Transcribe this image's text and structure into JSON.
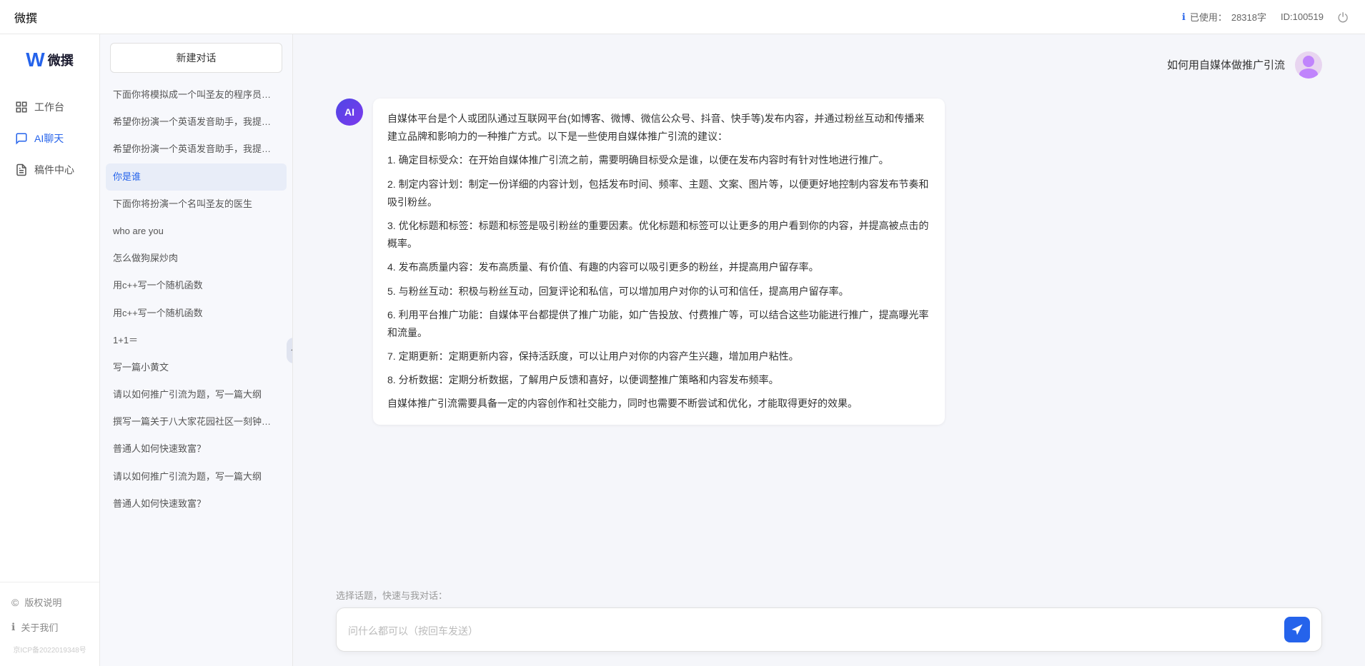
{
  "topbar": {
    "title": "微撰",
    "usage_label": "已使用：",
    "usage_value": "28318字",
    "id_label": "ID:100519",
    "power_icon": "⏻"
  },
  "logo": {
    "w": "W",
    "text": "微撰"
  },
  "nav": {
    "items": [
      {
        "id": "workbench",
        "icon": "🖥",
        "label": "工作台"
      },
      {
        "id": "ai-chat",
        "icon": "💬",
        "label": "AI聊天",
        "active": true
      },
      {
        "id": "drafts",
        "icon": "📋",
        "label": "稿件中心"
      }
    ]
  },
  "sidebar_bottom": {
    "items": [
      {
        "id": "copyright",
        "icon": "©",
        "label": "版权说明"
      },
      {
        "id": "about",
        "icon": "ℹ",
        "label": "关于我们"
      }
    ],
    "icp": "京ICP备2022019348号"
  },
  "new_chat_label": "新建对话",
  "history": {
    "items": [
      {
        "id": 1,
        "text": "下面你将模拟成一个叫圣友的程序员、我说..."
      },
      {
        "id": 2,
        "text": "希望你扮演一个英语发音助手，我提供给你..."
      },
      {
        "id": 3,
        "text": "希望你扮演一个英语发音助手，我提供给你..."
      },
      {
        "id": 4,
        "text": "你是谁",
        "active": true
      },
      {
        "id": 5,
        "text": "下面你将扮演一个名叫圣友的医生"
      },
      {
        "id": 6,
        "text": "who are you"
      },
      {
        "id": 7,
        "text": "怎么做狗屎炒肉"
      },
      {
        "id": 8,
        "text": "用c++写一个随机函数"
      },
      {
        "id": 9,
        "text": "用c++写一个随机函数"
      },
      {
        "id": 10,
        "text": "1+1＝"
      },
      {
        "id": 11,
        "text": "写一篇小黄文"
      },
      {
        "id": 12,
        "text": "请以如何推广引流为题，写一篇大纲"
      },
      {
        "id": 13,
        "text": "撰写一篇关于八大家花园社区一刻钟便民生..."
      },
      {
        "id": 14,
        "text": "普通人如何快速致富？"
      },
      {
        "id": 15,
        "text": "请以如何推广引流为题，写一篇大纲"
      },
      {
        "id": 16,
        "text": "普通人如何快速致富？"
      }
    ]
  },
  "chat": {
    "user_question": "如何用自媒体做推广引流",
    "ai_response": {
      "paragraphs": [
        "自媒体平台是个人或团队通过互联网平台(如博客、微博、微信公众号、抖音、快手等)发布内容，并通过粉丝互动和传播来建立品牌和影响力的一种推广方式。以下是一些使用自媒体推广引流的建议：",
        "1. 确定目标受众：在开始自媒体推广引流之前，需要明确目标受众是谁，以便在发布内容时有针对性地进行推广。",
        "2. 制定内容计划：制定一份详细的内容计划，包括发布时间、频率、主题、文案、图片等，以便更好地控制内容发布节奏和吸引粉丝。",
        "3. 优化标题和标签：标题和标签是吸引粉丝的重要因素。优化标题和标签可以让更多的用户看到你的内容，并提高被点击的概率。",
        "4. 发布高质量内容：发布高质量、有价值、有趣的内容可以吸引更多的粉丝，并提高用户留存率。",
        "5. 与粉丝互动：积极与粉丝互动，回复评论和私信，可以增加用户对你的认可和信任，提高用户留存率。",
        "6. 利用平台推广功能：自媒体平台都提供了推广功能，如广告投放、付费推广等，可以结合这些功能进行推广，提高曝光率和流量。",
        "7. 定期更新：定期更新内容，保持活跃度，可以让用户对你的内容产生兴趣，增加用户粘性。",
        "8. 分析数据：定期分析数据，了解用户反馈和喜好，以便调整推广策略和内容发布频率。",
        "自媒体推广引流需要具备一定的内容创作和社交能力，同时也需要不断尝试和优化，才能取得更好的效果。"
      ]
    },
    "quick_topics_label": "选择话题，快速与我对话：",
    "input_placeholder": "问什么都可以（按回车发送）"
  }
}
